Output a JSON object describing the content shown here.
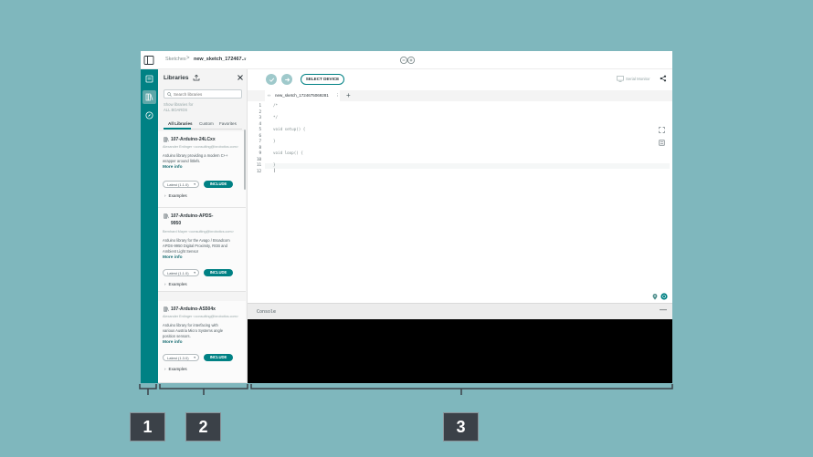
{
  "breadcrumb": {
    "root": "Sketches",
    "separator": ">",
    "sketch_name": "new_sketch_172467...",
    "caret": "▾"
  },
  "libraries": {
    "title": "Libraries",
    "search_placeholder": "Search libraries",
    "filter_label": "Show libraries for",
    "filter_value": "ALL BOARDS",
    "tabs": [
      "All Libraries",
      "Custom",
      "Favorites"
    ],
    "cards": [
      {
        "name_lines": [
          "107-Arduino-24LCxx"
        ],
        "author": "Alexander Entinger <consulting@lxrobotics.com>",
        "description_lines": [
          "Arduino library providing a modern C++",
          "wrapper around littlefs."
        ],
        "more_info": "More info",
        "version": "Latest (1.1.0)",
        "include": "INCLUDE",
        "examples": "Examples"
      },
      {
        "name_lines": [
          "107-Arduino-APDS-",
          "9950"
        ],
        "author": "Bernhard Mayer <consulting@lxrobotics.com>",
        "description_lines": [
          "Arduino library for the Avago / Broadcom",
          "APDS-9950 Digital Proximity, RGB and",
          "Ambient Light Sensor"
        ],
        "more_info": "More info",
        "version": "Latest (1.1.0)",
        "include": "INCLUDE",
        "examples": "Examples"
      },
      {
        "name_lines": [
          "107-Arduino-AS504x"
        ],
        "author": "Alexander Entinger <consulting@lxrobotics.com>",
        "description_lines": [
          "Arduino library for interfacing with",
          "various Austria Micro Systems angle",
          "position sensors."
        ],
        "more_info": "More info",
        "version": "Latest (1.3.0)",
        "include": "INCLUDE",
        "examples": "Examples"
      }
    ]
  },
  "toolbar": {
    "verify_icon": "check-icon",
    "upload_icon": "arrow-right-icon",
    "select_device": "SELECT DEVICE",
    "serial_monitor": "Serial Monitor"
  },
  "file_tab": {
    "name": "new_sketch_1724675069281",
    "more": "⋮",
    "add": "+"
  },
  "editor": {
    "line_numbers": [
      "1",
      "2",
      "3",
      "4",
      "5",
      "6",
      "7",
      "8",
      "9",
      "10",
      "11",
      "12"
    ],
    "lines": [
      "/*",
      "",
      "*/",
      "",
      "void setup() {",
      "",
      "}",
      "",
      "void loop() {",
      "",
      "}",
      ""
    ]
  },
  "console": {
    "title": "Console",
    "minimize": "—"
  },
  "markers": [
    "1",
    "2",
    "3"
  ],
  "colors": {
    "background": "#7fb7bd",
    "rail": "#008184",
    "accent": "#008184",
    "console": "#000000"
  }
}
